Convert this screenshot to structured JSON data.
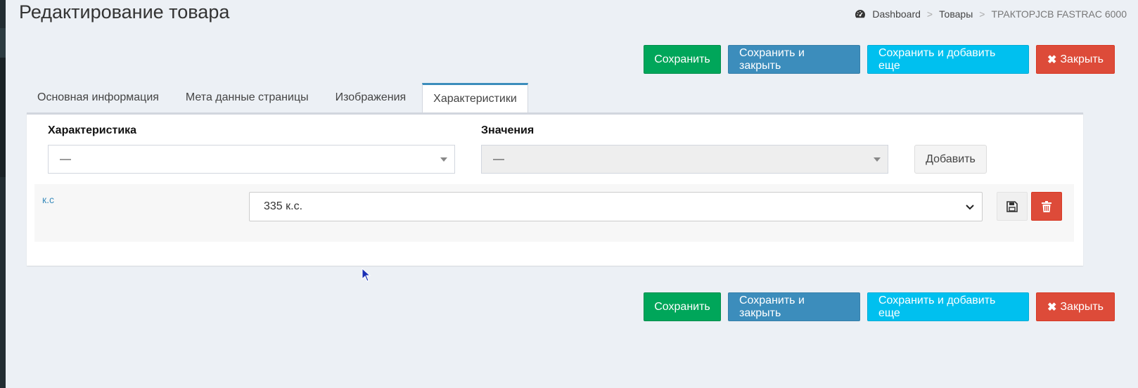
{
  "page": {
    "title": "Редактирование товара"
  },
  "breadcrumb": {
    "icon": "dashboard-icon",
    "items": [
      "Dashboard",
      "Товары"
    ],
    "current": "ТРАКТОРJCB FASTRAC 6000"
  },
  "actions": {
    "save": "Сохранить",
    "save_close": "Сохранить и закрыть",
    "save_add": "Сохранить и добавить еще",
    "close": "Закрыть",
    "close_icon": "✖"
  },
  "tabs": [
    {
      "label": "Основная информация",
      "active": false
    },
    {
      "label": "Мета данные страницы",
      "active": false
    },
    {
      "label": "Изображения",
      "active": false
    },
    {
      "label": "Характеристики",
      "active": true
    }
  ],
  "form": {
    "characteristic_label": "Характеристика",
    "characteristic_value": "—",
    "values_label": "Значения",
    "values_value": "—",
    "add_label": "Добавить"
  },
  "rows": [
    {
      "name": "к.с",
      "value": "335 к.с."
    }
  ],
  "colors": {
    "success": "#00a65a",
    "primary": "#3c8dbc",
    "info": "#00c0ef",
    "danger": "#dd4b39",
    "background": "#ecf0f5"
  }
}
